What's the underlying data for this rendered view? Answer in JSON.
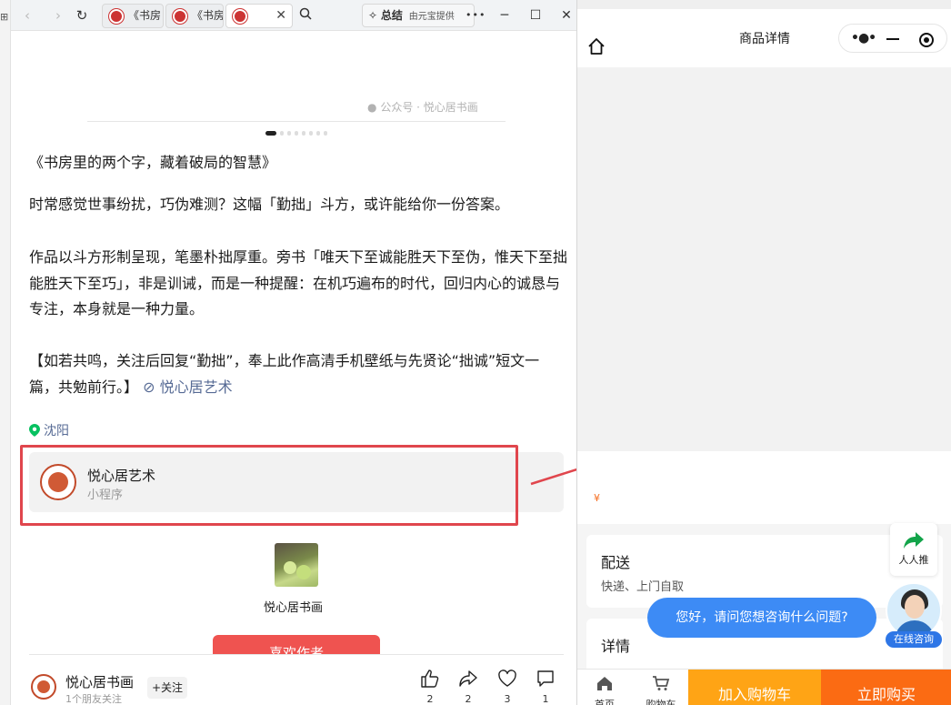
{
  "browser": {
    "tabs": [
      {
        "label": "《书房"
      },
      {
        "label": "《书房"
      },
      {
        "label": ""
      }
    ],
    "summary_label": "总结",
    "summary_provider": "由元宝提供",
    "more_label": "•••"
  },
  "article": {
    "watermark": "公众号 · 悦心居书画",
    "title": "《书房里的两个字，藏着破局的智慧》",
    "para1": "时常感觉世事纷扰，巧伪难测？这幅「勤拙」斗方，或许能给你一份答案。",
    "para2": "作品以斗方形制呈现，笔墨朴拙厚重。旁书「唯天下至诚能胜天下至伪，惟天下至拙能胜天下至巧」，非是训诫，而是一种提醒：在机巧遍布的时代，回归内心的诚恳与专注，本身就是一种力量。",
    "para3": "【如若共鸣，关注后回复“勤拙”，奉上此作高清手机壁纸与先贤论“拙诚”短文一篇，共勉前行。】",
    "mention": "悦心居艺术",
    "location": "沈阳",
    "mini_program": {
      "name": "悦心居艺术",
      "type": "小程序"
    },
    "author_card_name": "悦心居书画",
    "reward_label": "喜欢作者"
  },
  "footer": {
    "account_name": "悦心居书画",
    "friends_follow": "1个朋友关注",
    "follow_label": "+关注",
    "actions": [
      {
        "icon": "thumbs-up-icon",
        "count": "2"
      },
      {
        "icon": "share-icon",
        "count": "2"
      },
      {
        "icon": "heart-icon",
        "count": "3"
      },
      {
        "icon": "comment-icon",
        "count": "1"
      }
    ]
  },
  "mini_app": {
    "title": "商品详情",
    "currency": "¥",
    "share_label": "人人推",
    "delivery_title": "配送",
    "delivery_methods": "快递、上门自取",
    "detail_title": "详情",
    "chat_prompt": "您好，请问您想咨询什么问题?",
    "agent_label": "在线咨询",
    "tab_home": "首页",
    "tab_cart": "购物车",
    "add_cart_label": "加入购物车",
    "buy_now_label": "立即购买"
  },
  "colors": {
    "accent_blue": "#576b95",
    "highlight_frame": "#e0464d",
    "cart_orange": "#ffa415",
    "buy_orange": "#fb6b13",
    "chat_blue": "#3d8bf5"
  }
}
